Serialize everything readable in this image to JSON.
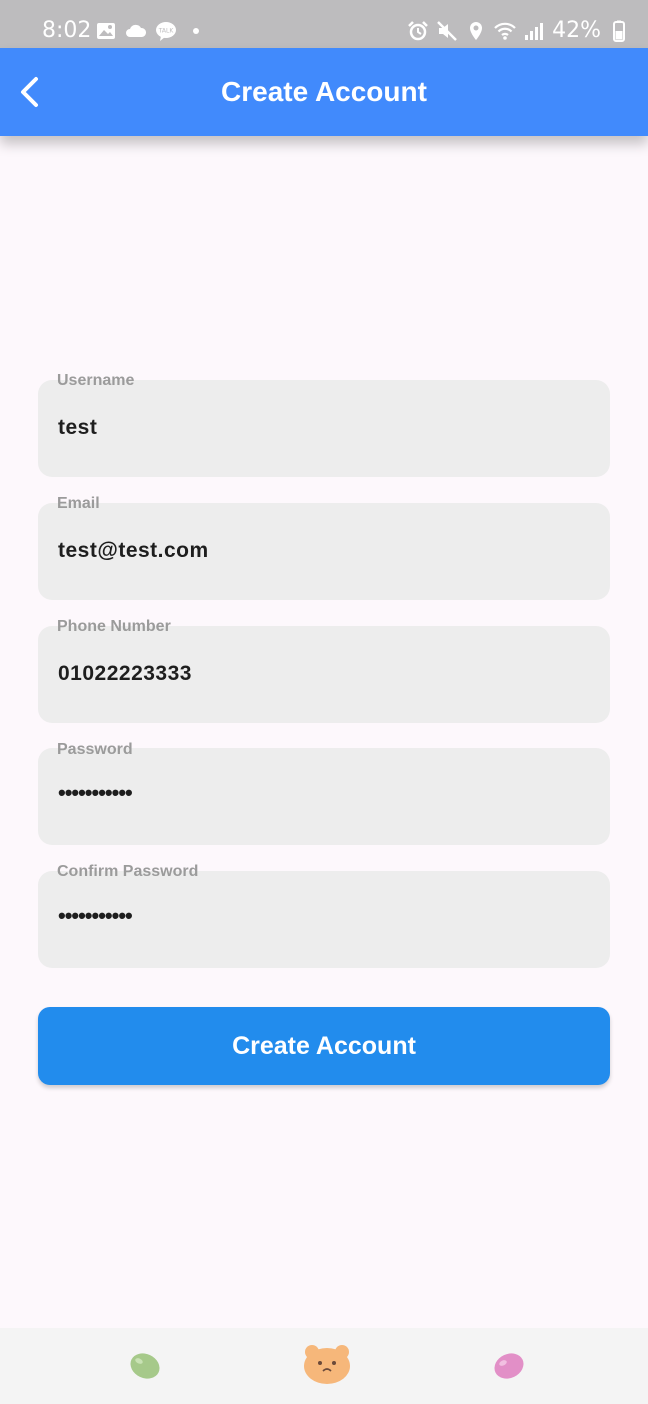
{
  "status_bar": {
    "time": "8:02",
    "battery": "42%",
    "left_icons": [
      "gallery-icon",
      "cloud-icon",
      "talk-icon",
      "dot-icon"
    ],
    "right_icons": [
      "alarm-icon",
      "mute-icon",
      "location-icon",
      "wifi-icon",
      "signal-icon",
      "battery-icon"
    ]
  },
  "app_bar": {
    "title": "Create Account",
    "back_icon": "chevron-left-icon",
    "color": "#418afc"
  },
  "form": {
    "username": {
      "label": "Username",
      "value": "test"
    },
    "email": {
      "label": "Email",
      "value": "test@test.com"
    },
    "phone": {
      "label": "Phone Number",
      "value": "01022223333"
    },
    "password": {
      "label": "Password",
      "value": "•••••••••••"
    },
    "confirm_password": {
      "label": "Confirm Password",
      "value": "•••••••••••"
    }
  },
  "create_button": {
    "label": "Create Account",
    "color": "#228ced"
  },
  "bottom_nav": {
    "items": [
      {
        "icon": "green-jellybean-icon",
        "color": "#a6c98a"
      },
      {
        "icon": "bear-face-icon",
        "color": "#f6b77a"
      },
      {
        "icon": "pink-jellybean-icon",
        "color": "#e28fc7"
      }
    ]
  }
}
